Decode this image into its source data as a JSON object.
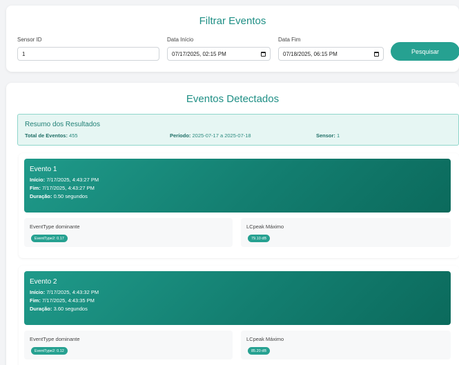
{
  "filter": {
    "title": "Filtrar Eventos",
    "sensor_label": "Sensor ID",
    "sensor_value": "1",
    "start_label": "Data Início",
    "start_value": "07/17/2025, 02:15 PM",
    "end_label": "Data Fim",
    "end_value": "07/18/2025, 06:15 PM",
    "search_label": "Pesquisar"
  },
  "events_section": {
    "title": "Eventos Detectados",
    "summary": {
      "title": "Resumo dos Resultados",
      "total_label": "Total de Eventos:",
      "total_value": "455",
      "period_label": "Período:",
      "period_value": "2025-07-17 a 2025-07-18",
      "sensor_label": "Sensor:",
      "sensor_value": "1"
    },
    "events": [
      {
        "title": "Evento 1",
        "start_label": "Início:",
        "start_value": "7/17/2025, 4:43:27 PM",
        "end_label": "Fim:",
        "end_value": "7/17/2025, 4:43:27 PM",
        "duration_label": "Duração:",
        "duration_value": "0.50 segundos",
        "eventtype_label": "EventType dominante",
        "eventtype_value": "EventType2: 0.17",
        "lcpeak_label": "LCpeak Máximo",
        "lcpeak_value": "79.10 dB"
      },
      {
        "title": "Evento 2",
        "start_label": "Início:",
        "start_value": "7/17/2025, 4:43:32 PM",
        "end_label": "Fim:",
        "end_value": "7/17/2025, 4:43:35 PM",
        "duration_label": "Duração:",
        "duration_value": "3.60 segundos",
        "eventtype_label": "EventType dominante",
        "eventtype_value": "EventType2: 0.12",
        "lcpeak_label": "LCpeak Máximo",
        "lcpeak_value": "85.20 dB"
      }
    ]
  },
  "colors": {
    "accent": "#26a191",
    "header_gradient_start": "#1f9a8a",
    "header_gradient_end": "#0b6a5c",
    "summary_bg": "#e6f6f3"
  },
  "icons": [
    "calendar-icon"
  ]
}
